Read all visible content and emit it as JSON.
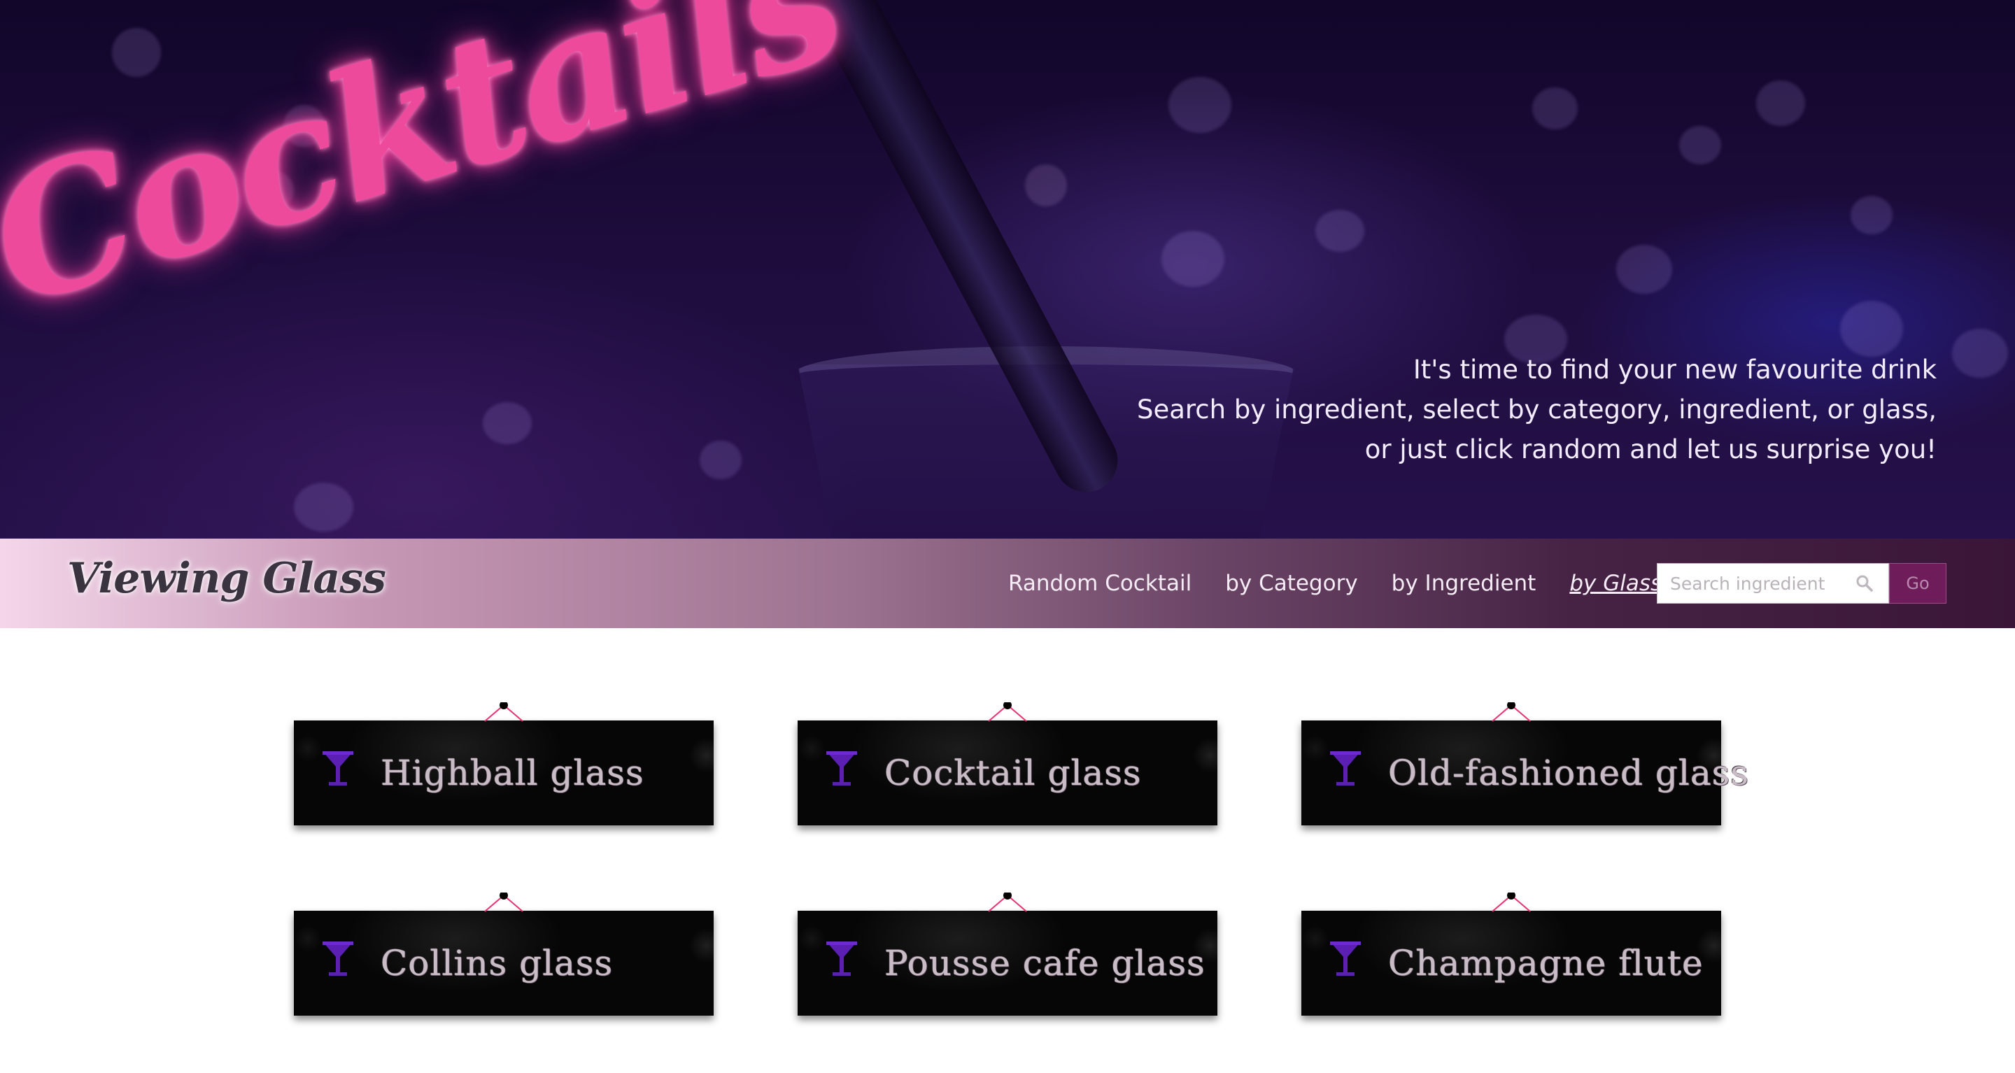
{
  "hero": {
    "title": "Cocktails",
    "tagline": [
      "It's time to find your new favourite drink",
      "Search by ingredient, select by category, ingredient, or glass,",
      "or just click random and let us surprise you!"
    ]
  },
  "navbar": {
    "brand": "Viewing Glass",
    "links": [
      {
        "label": "Random Cocktail",
        "active": false
      },
      {
        "label": "by Category",
        "active": false
      },
      {
        "label": "by Ingredient",
        "active": false
      },
      {
        "label": "by Glass",
        "active": true
      }
    ],
    "search": {
      "placeholder": "Search ingredient",
      "value": "",
      "icon": "search-icon",
      "go_label": "Go"
    }
  },
  "glasses": [
    {
      "label": "Highball glass",
      "icon": "cocktail-glass-icon"
    },
    {
      "label": "Cocktail glass",
      "icon": "cocktail-glass-icon"
    },
    {
      "label": "Old-fashioned glass",
      "icon": "cocktail-glass-icon"
    },
    {
      "label": "Collins glass",
      "icon": "cocktail-glass-icon"
    },
    {
      "label": "Pousse cafe glass",
      "icon": "cocktail-glass-icon"
    },
    {
      "label": "Champagne flute",
      "icon": "cocktail-glass-icon"
    }
  ],
  "colors": {
    "neon_pink": "#ee4a9c",
    "hanger_string": "#e8336f",
    "icon_purple": "#5b1fb3",
    "go_button": "#6e1d5a"
  }
}
